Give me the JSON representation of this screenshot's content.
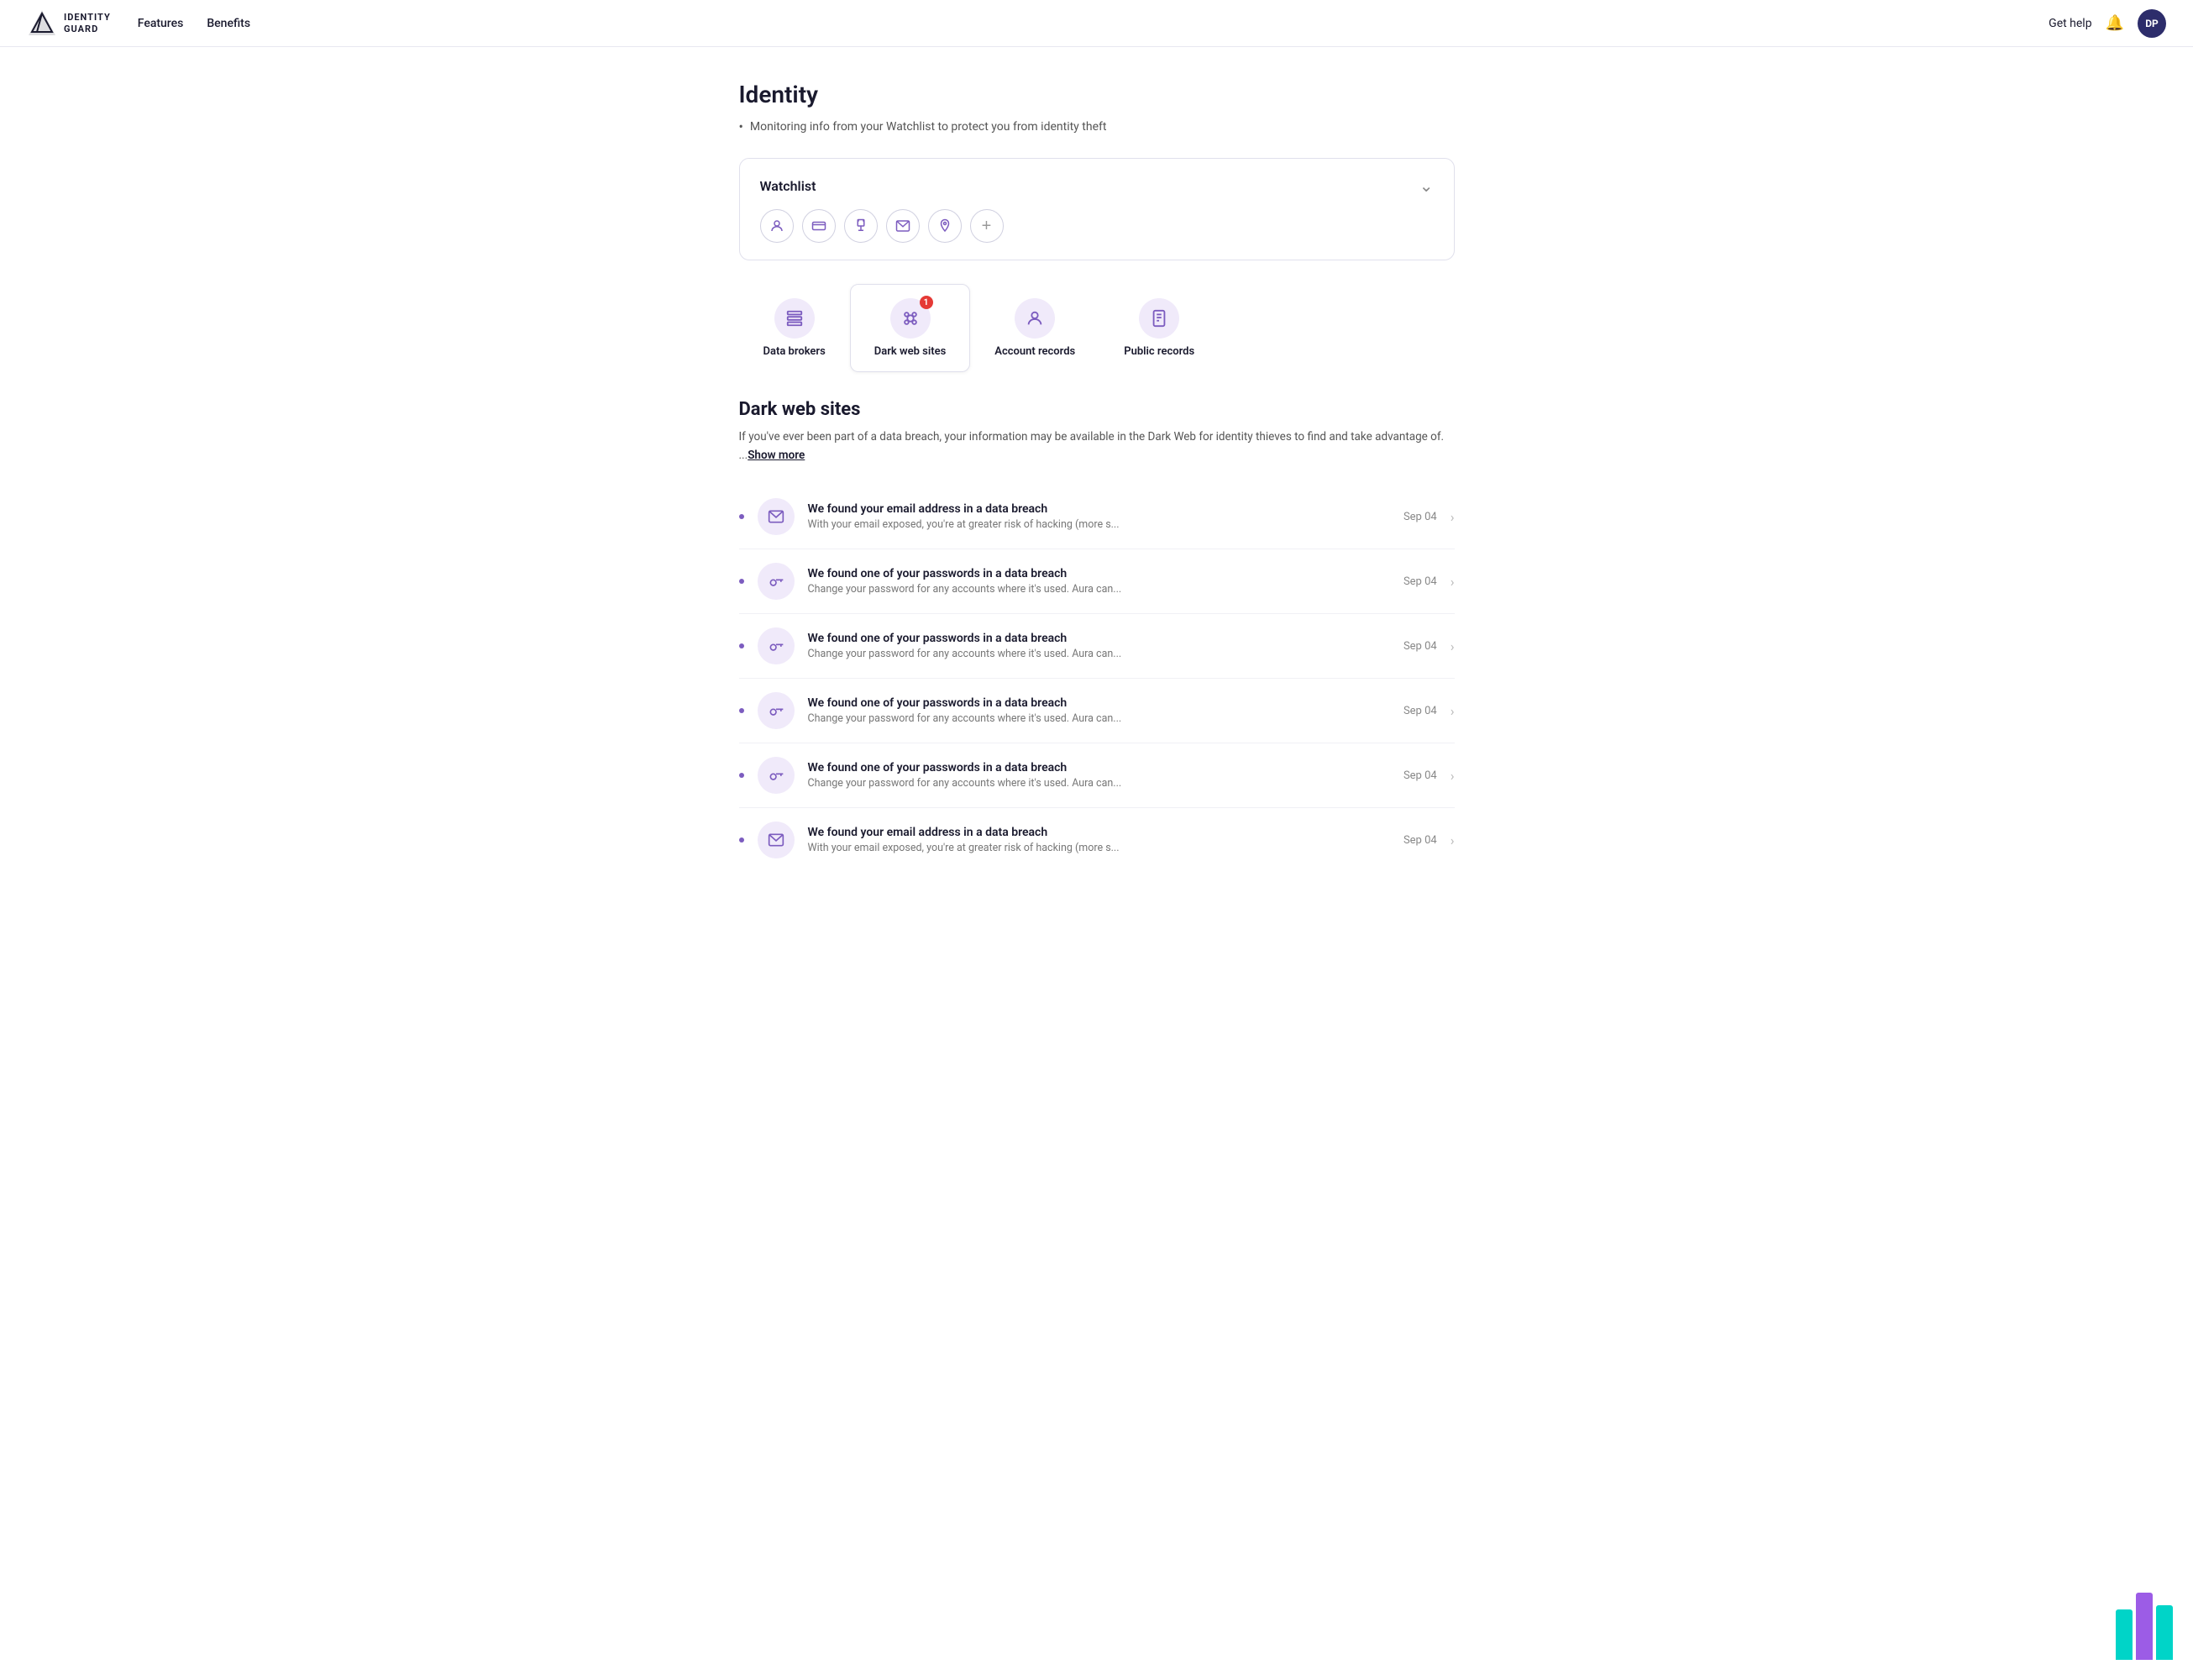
{
  "navbar": {
    "logo_text_line1": "IDENTITY",
    "logo_text_line2": "GUARD",
    "nav_features": "Features",
    "nav_benefits": "Benefits",
    "get_help": "Get help",
    "avatar_initials": "DP"
  },
  "page": {
    "title": "Identity",
    "subtitle": "Monitoring info from your Watchlist to protect you from identity theft"
  },
  "watchlist": {
    "title": "Watchlist",
    "icons": [
      "👤",
      "💳",
      "🔌",
      "✉",
      "📍",
      "+"
    ]
  },
  "tabs": [
    {
      "id": "data-brokers",
      "label": "Data brokers",
      "icon": "🗄",
      "badge": null,
      "active": false
    },
    {
      "id": "dark-web-sites",
      "label": "Dark web sites",
      "icon": "👁",
      "badge": "1",
      "active": true
    },
    {
      "id": "account-records",
      "label": "Account records",
      "icon": "👤",
      "badge": null,
      "active": false
    },
    {
      "id": "public-records",
      "label": "Public records",
      "icon": "📋",
      "badge": null,
      "active": false
    }
  ],
  "dark_web": {
    "section_title": "Dark web sites",
    "description": "If you've ever been part of a data breach, your information may be available in the Dark Web for identity thieves to find and take advantage of. ...",
    "show_more_label": "Show more",
    "alerts": [
      {
        "title": "We found your email address in a data breach",
        "desc": "With your email exposed, you're at greater risk of hacking (more s...",
        "date": "Sep 04",
        "icon_type": "email"
      },
      {
        "title": "We found one of your passwords in a data breach",
        "desc": "Change your password for any accounts where it's used. Aura can...",
        "date": "Sep 04",
        "icon_type": "key"
      },
      {
        "title": "We found one of your passwords in a data breach",
        "desc": "Change your password for any accounts where it's used. Aura can...",
        "date": "Sep 04",
        "icon_type": "key"
      },
      {
        "title": "We found one of your passwords in a data breach",
        "desc": "Change your password for any accounts where it's used. Aura can...",
        "date": "Sep 04",
        "icon_type": "key"
      },
      {
        "title": "We found one of your passwords in a data breach",
        "desc": "Change your password for any accounts where it's used. Aura can...",
        "date": "Sep 04",
        "icon_type": "key"
      },
      {
        "title": "We found your email address in a data breach",
        "desc": "With your email exposed, you're at greater risk of hacking (more s...",
        "date": "Sep 04",
        "icon_type": "email"
      }
    ]
  }
}
